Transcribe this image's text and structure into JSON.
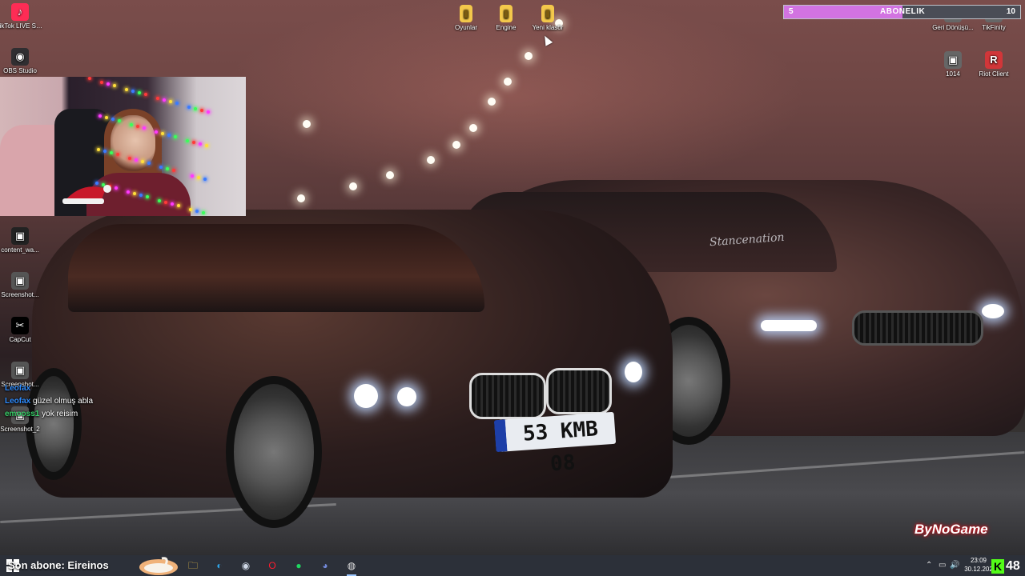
{
  "desktop": {
    "icons_left": [
      {
        "label": "TikTok LIVE Studio",
        "icon": "tiktok-live-icon",
        "color": "#fe2c55"
      },
      {
        "label": "OBS Studio",
        "icon": "obs-icon",
        "color": "#302e31"
      },
      {
        "label": "content_wa...",
        "icon": "image-file-icon",
        "color": "#222222"
      },
      {
        "label": "Screenshot...",
        "icon": "image-file-icon",
        "color": "#555555"
      },
      {
        "label": "CapCut",
        "icon": "capcut-icon",
        "color": "#000000"
      },
      {
        "label": "Screenshot...",
        "icon": "image-file-icon",
        "color": "#555555"
      },
      {
        "label": "Screenshot_2",
        "icon": "image-file-icon",
        "color": "#555555"
      }
    ],
    "icons_top": [
      {
        "label": "Oyunlar",
        "icon": "folder-icon"
      },
      {
        "label": "Engine",
        "icon": "folder-icon"
      },
      {
        "label": "Yeni klasör",
        "icon": "folder-icon"
      }
    ],
    "icons_right": [
      {
        "label": "Geri Dönüşü...",
        "icon": "recycle-bin-icon"
      },
      {
        "label": "TikFinity",
        "icon": "tikfinity-icon"
      },
      {
        "label": "1014",
        "icon": "image-file-icon"
      },
      {
        "label": "Riot Client",
        "icon": "riot-client-icon",
        "color": "#d13639"
      }
    ]
  },
  "wallpaper": {
    "plate_text": "53 KMB 08",
    "car_script": "Stancenation"
  },
  "subscriber_goal": {
    "start": "5",
    "label": "ABONELIK",
    "end": "10",
    "progress_fraction": 0.5,
    "fill_color": "#d273e1"
  },
  "chat": [
    {
      "user": "Leofax",
      "message": "",
      "user_color": "#2e8cff"
    },
    {
      "user": "Leofax",
      "message": "güzel olmuş abla",
      "user_color": "#2e8cff"
    },
    {
      "user": "emooss1",
      "message": "yok reisim",
      "user_color": "#3ad06a"
    }
  ],
  "watermark": "ByNoGame",
  "taskbar": {
    "ticker": "Son abone: Eireinos",
    "apps": [
      {
        "name": "file-explorer-icon",
        "glyph": "🗀",
        "color": "#f3c84b"
      },
      {
        "name": "edge-icon",
        "glyph": "◐",
        "color": "#2fa3e6"
      },
      {
        "name": "steam-icon",
        "glyph": "◉",
        "color": "#cfd8e6"
      },
      {
        "name": "opera-icon",
        "glyph": "O",
        "color": "#ff1b2d"
      },
      {
        "name": "spotify-icon",
        "glyph": "●",
        "color": "#1ed760"
      },
      {
        "name": "discord-icon",
        "glyph": "◕",
        "color": "#7289da"
      },
      {
        "name": "obs-icon",
        "glyph": "◍",
        "color": "#e0e0e0"
      }
    ],
    "clock_time": "23:09",
    "clock_date": "30.12.202",
    "viewer_count": "48",
    "kick_letter": "K"
  }
}
